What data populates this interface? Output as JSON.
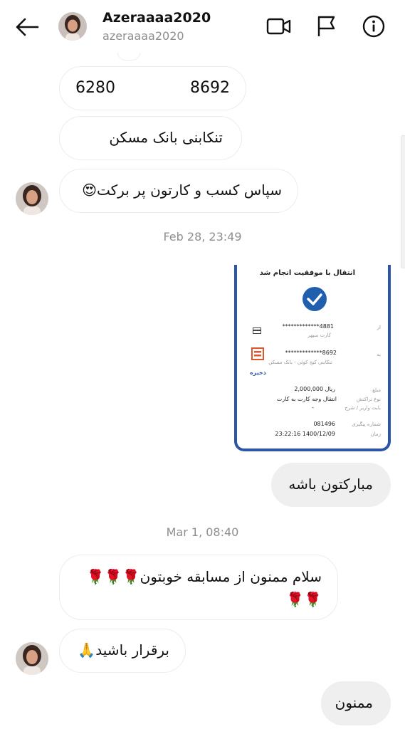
{
  "header": {
    "display_name": "Azeraaaa2020",
    "username": "azeraaaa2020",
    "icons": [
      "back-arrow-icon",
      "video-camera-icon",
      "flag-icon",
      "info-icon"
    ]
  },
  "messages": {
    "card_left": "6280",
    "card_right": "8692",
    "bank_name": "تنکابنی بانک مسکن",
    "thanks": "سپاس کسب و کارتون پر برکت😍",
    "timestamp_1": "Feb 28, 23:49",
    "congrats": "مبارکتون باشه",
    "timestamp_2": "Mar 1, 08:40",
    "greeting_line1": "سلام ممنون از مسابقه خوبتون🌹🌹🌹",
    "greeting_line2": "🌹🌹",
    "stay_well": "برقرار باشید🙏",
    "thank_you": "ممنون"
  },
  "receipt": {
    "title": "انتقال با موفقیت انجام شد",
    "from_label": "از",
    "from_card": "*************4881",
    "from_sub": "کارت سپهر",
    "to_label": "به",
    "to_card": "*************8692",
    "to_sub": "تنکابنی کیج کوثی - بانک مسکن",
    "save_label": "ذخیره",
    "amount_label": "مبلغ",
    "amount": "2,000,000 ریال",
    "type_label": "نوع تراکنش",
    "type_value": "انتقال وجه کارت به کارت",
    "desc_label": "بابت واریز / شرح",
    "desc_value": "-",
    "tracking_label": "شماره پیگیری",
    "tracking_value": "081496",
    "time_label": "زمان",
    "time_value": "23:22:16   1400/12/09",
    "colors": {
      "accent": "#2b56a8",
      "check": "#1f5fae"
    }
  }
}
